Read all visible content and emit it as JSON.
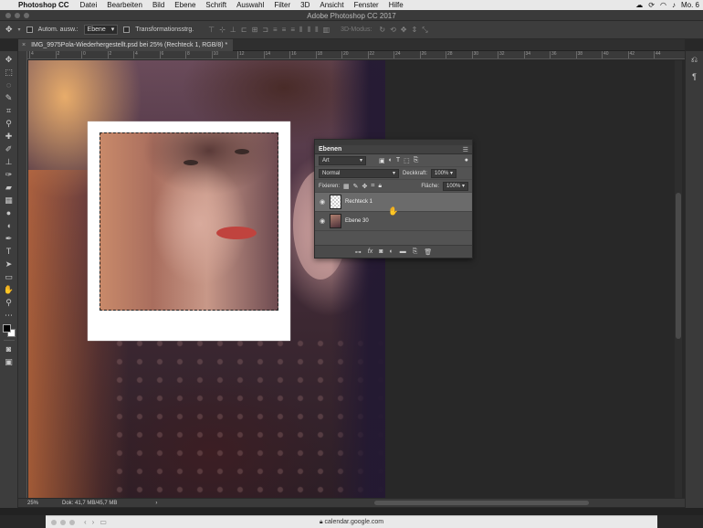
{
  "menubar": {
    "app_name": "Photoshop CC",
    "items": [
      "Datei",
      "Bearbeiten",
      "Bild",
      "Ebene",
      "Schrift",
      "Auswahl",
      "Filter",
      "3D",
      "Ansicht",
      "Fenster",
      "Hilfe"
    ],
    "clock": "Mo. 6"
  },
  "window": {
    "title": "Adobe Photoshop CC 2017"
  },
  "options_bar": {
    "auto_select_label": "Autom. ausw.:",
    "auto_select_value": "Ebene",
    "transform_label": "Transformationsstrg.",
    "mode_3d_label": "3D-Modus:"
  },
  "document": {
    "tab_title": "IMG_9975Pola-Wiederhergestellt.psd bei 25% (Rechteck 1, RGB/8) *"
  },
  "rulers": {
    "top_ticks": [
      "4",
      "2",
      "0",
      "2",
      "4",
      "6",
      "8",
      "10",
      "12",
      "14",
      "16",
      "18",
      "20",
      "22",
      "24",
      "26",
      "28",
      "30",
      "32",
      "34",
      "36",
      "38",
      "40",
      "42",
      "44"
    ]
  },
  "layers_panel": {
    "title": "Ebenen",
    "filter_value": "Art",
    "blend_mode": "Normal",
    "opacity_label": "Deckkraft:",
    "opacity_value": "100%",
    "lock_label": "Fixieren:",
    "fill_label": "Fläche:",
    "fill_value": "100%",
    "layers": [
      {
        "name": "Rechteck 1",
        "selected": true
      },
      {
        "name": "Ebene 30",
        "selected": false
      }
    ]
  },
  "status_bar": {
    "zoom": "25%",
    "doc_info": "Dok: 41,7 MB/45,7 MB"
  },
  "browser": {
    "url": "calendar.google.com"
  }
}
